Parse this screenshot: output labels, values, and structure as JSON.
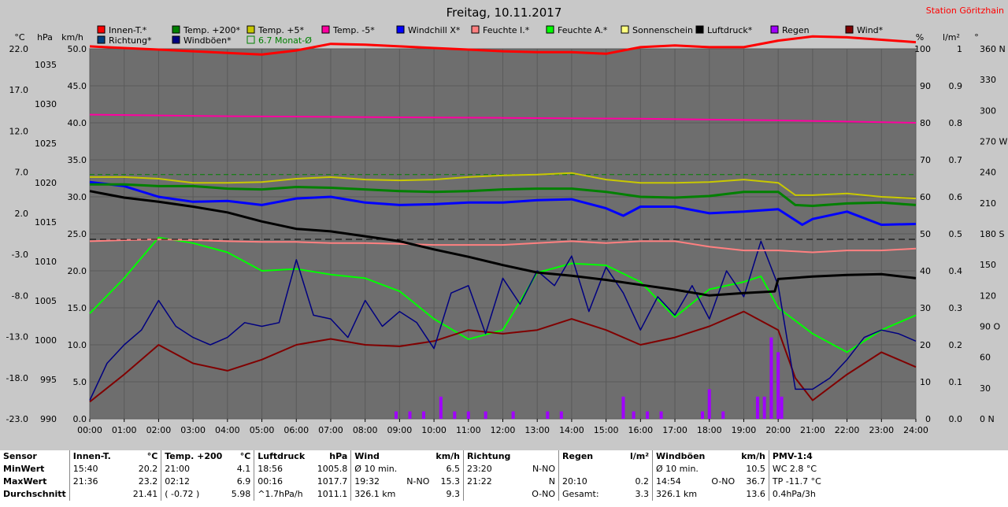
{
  "chart_data": {
    "type": "line",
    "title": "Freitag, 10.11.2017",
    "station": "Station Göritzhain",
    "x_ticks": [
      "00:00",
      "01:00",
      "02:00",
      "03:00",
      "04:00",
      "05:00",
      "06:00",
      "07:00",
      "08:00",
      "09:00",
      "10:00",
      "11:00",
      "12:00",
      "13:00",
      "14:00",
      "15:00",
      "16:00",
      "17:00",
      "18:00",
      "19:00",
      "20:00",
      "21:00",
      "22:00",
      "23:00",
      "24:00"
    ],
    "xlim": [
      0,
      24
    ],
    "axes": {
      "temp_c": {
        "label": "°C",
        "ticks": [
          "22.0",
          "17.0",
          "12.0",
          "7.0",
          "2.0",
          "-3.0",
          "-8.0",
          "-13.0",
          "-18.0",
          "-23.0"
        ],
        "range": [
          -23,
          22
        ]
      },
      "pressure_hpa": {
        "label": "hPa",
        "ticks": [
          "1035",
          "1030",
          "1025",
          "1020",
          "1015",
          "1010",
          "1005",
          "1000",
          "995",
          "990"
        ],
        "range": [
          990,
          1035
        ]
      },
      "wind_kmh": {
        "label": "km/h",
        "ticks": [
          "50.0",
          "45.0",
          "40.0",
          "35.0",
          "30.0",
          "25.0",
          "20.0",
          "15.0",
          "10.0",
          "5.0",
          "0.0"
        ],
        "range": [
          0,
          50
        ]
      },
      "humidity_pct": {
        "label": "%",
        "ticks": [
          "100",
          "90",
          "80",
          "70",
          "60",
          "50",
          "40",
          "30",
          "20",
          "10",
          "0"
        ],
        "range": [
          0,
          100
        ]
      },
      "rain_lm2": {
        "label": "l/m²",
        "ticks": [
          "1",
          "0.9",
          "0.8",
          "0.7",
          "0.6",
          "0.5",
          "0.4",
          "0.3",
          "0.2",
          "0.1",
          "0.0"
        ],
        "range": [
          0,
          1
        ]
      },
      "direction_deg": {
        "label": "°",
        "ticks": [
          "360 N",
          "330",
          "300",
          "270 W",
          "240",
          "210",
          "180 S",
          "150",
          "120",
          "90 O",
          "60",
          "30",
          "0 N"
        ],
        "range": [
          0,
          360
        ]
      }
    },
    "legend": [
      {
        "name": "Innen-T.*",
        "color": "#ff0000"
      },
      {
        "name": "Temp. +200*",
        "color": "#008000"
      },
      {
        "name": "Temp. +5*",
        "color": "#c8c800"
      },
      {
        "name": "Temp. -5*",
        "color": "#ff00a0"
      },
      {
        "name": "Windchill X*",
        "color": "#0000ff"
      },
      {
        "name": "Feuchte I.*",
        "color": "#ff8080"
      },
      {
        "name": "Feuchte A.*",
        "color": "#00ff00"
      },
      {
        "name": "Sonnenschein",
        "color": "#ffff80"
      },
      {
        "name": "Luftdruck*",
        "color": "#000000"
      },
      {
        "name": "Regen",
        "color": "#a000ff"
      },
      {
        "name": "Wind*",
        "color": "#800000"
      },
      {
        "name": "Richtung*",
        "color": "#004080"
      },
      {
        "name": "Windböen*",
        "color": "#000080"
      },
      {
        "name": "6.7 Monat-Ø",
        "color": "#008000"
      }
    ],
    "series": [
      {
        "name": "Innen-T.*",
        "axis": "temp_c",
        "x": [
          0,
          1,
          2,
          3,
          4,
          5,
          6,
          7,
          8,
          9,
          10,
          11,
          12,
          13,
          14,
          15,
          16,
          17,
          18,
          19,
          20,
          21,
          22,
          23,
          24
        ],
        "y": [
          22.3,
          22.1,
          21.9,
          21.7,
          21.5,
          21.3,
          21.8,
          22.6,
          22.5,
          22.3,
          22.1,
          21.9,
          21.7,
          21.6,
          21.6,
          21.4,
          22.2,
          22.4,
          22.2,
          22.2,
          23.0,
          23.5,
          23.4,
          23.1,
          22.8
        ]
      },
      {
        "name": "Temp. -5*",
        "axis": "temp_c",
        "x": [
          0,
          4,
          8,
          12,
          16,
          20,
          24
        ],
        "y": [
          14.0,
          13.8,
          13.7,
          13.6,
          13.5,
          13.3,
          13.0
        ]
      },
      {
        "name": "Temp. +5*",
        "axis": "temp_c",
        "x": [
          0,
          1,
          2,
          3,
          4,
          5,
          6,
          7,
          8,
          9,
          10,
          11,
          12,
          13,
          14,
          15,
          16,
          17,
          18,
          19,
          20,
          20.5,
          21,
          22,
          23,
          24
        ],
        "y": [
          6.4,
          6.4,
          6.2,
          5.7,
          5.7,
          5.8,
          6.2,
          6.4,
          6.1,
          6.0,
          6.1,
          6.4,
          6.6,
          6.7,
          6.9,
          6.1,
          5.7,
          5.7,
          5.8,
          6.1,
          5.7,
          4.2,
          4.2,
          4.4,
          4.0,
          3.8
        ]
      },
      {
        "name": "Temp. +200*",
        "axis": "temp_c",
        "x": [
          0,
          1,
          2,
          3,
          4,
          5,
          6,
          7,
          8,
          9,
          10,
          11,
          12,
          13,
          14,
          15,
          16,
          17,
          18,
          19,
          20,
          20.5,
          21,
          22,
          23,
          24
        ],
        "y": [
          5.5,
          5.5,
          5.3,
          5.3,
          5.0,
          4.9,
          5.2,
          5.1,
          4.9,
          4.7,
          4.6,
          4.7,
          4.9,
          5.0,
          5.0,
          4.6,
          4.0,
          3.9,
          4.1,
          4.6,
          4.6,
          3.0,
          2.9,
          3.2,
          3.3,
          3.0
        ]
      },
      {
        "name": "Windchill X*",
        "axis": "temp_c",
        "x": [
          0,
          1,
          2,
          3,
          4,
          5,
          6,
          7,
          8,
          9,
          10,
          11,
          12,
          13,
          14,
          15,
          15.5,
          16,
          17,
          18,
          19,
          20,
          20.7,
          21,
          22,
          23,
          24
        ],
        "y": [
          5.8,
          5.3,
          4.0,
          3.4,
          3.5,
          3.0,
          3.8,
          4.0,
          3.3,
          3.0,
          3.1,
          3.3,
          3.3,
          3.6,
          3.7,
          2.6,
          1.7,
          2.8,
          2.8,
          2.0,
          2.2,
          2.5,
          0.6,
          1.3,
          2.2,
          0.6,
          0.7
        ]
      },
      {
        "name": "Luftdruck*",
        "axis": "pressure_hpa",
        "x": [
          0,
          1,
          2,
          3,
          4,
          5,
          6,
          7,
          8,
          9,
          10,
          11,
          12,
          13,
          14,
          15,
          16,
          17,
          18,
          19,
          19.9,
          20,
          21,
          22,
          23,
          24
        ],
        "y": [
          1017.7,
          1016.9,
          1016.4,
          1015.8,
          1015.1,
          1014.0,
          1013.1,
          1012.8,
          1012.2,
          1011.6,
          1010.6,
          1009.7,
          1008.7,
          1007.8,
          1007.4,
          1006.9,
          1006.3,
          1005.7,
          1005.0,
          1005.3,
          1005.5,
          1007.0,
          1007.3,
          1007.5,
          1007.6,
          1007.1
        ]
      },
      {
        "name": "Feuchte I.*",
        "axis": "humidity_pct",
        "x": [
          0,
          1,
          2,
          3,
          4,
          5,
          6,
          7,
          8,
          9,
          10,
          11,
          12,
          13,
          14,
          15,
          16,
          17,
          18,
          19,
          20,
          21,
          22,
          23,
          24
        ],
        "y": [
          48.0,
          48.3,
          48.5,
          48.3,
          48.0,
          47.8,
          47.8,
          47.5,
          47.5,
          47.3,
          47.0,
          47.0,
          47.0,
          47.5,
          48.0,
          47.5,
          48.0,
          48.0,
          46.5,
          45.5,
          45.5,
          45.0,
          45.5,
          45.5,
          46.0
        ]
      },
      {
        "name": "Feuchte A.*",
        "axis": "humidity_pct",
        "x": [
          0,
          1,
          2,
          3,
          4,
          5,
          6,
          7,
          8,
          9,
          10,
          11,
          12,
          13,
          14,
          15,
          16,
          17,
          18,
          19,
          19.5,
          20,
          21,
          22,
          23,
          24
        ],
        "y": [
          28.5,
          38.0,
          49.0,
          47.5,
          45.0,
          40.0,
          40.5,
          39.0,
          38.0,
          34.5,
          27.0,
          21.5,
          24.0,
          39.5,
          42.0,
          41.5,
          37.0,
          27.5,
          35.0,
          37.0,
          38.5,
          30.0,
          23.0,
          18.0,
          24.0,
          28.0
        ]
      },
      {
        "name": "Wind*",
        "axis": "wind_kmh",
        "x": [
          0,
          1,
          2,
          3,
          4,
          5,
          6,
          7,
          8,
          9,
          10,
          11,
          12,
          13,
          14,
          15,
          16,
          17,
          18,
          19,
          20,
          20.5,
          21,
          22,
          23,
          24
        ],
        "y": [
          2.3,
          6.0,
          10.0,
          7.5,
          6.5,
          8.0,
          10.0,
          10.8,
          10.0,
          9.8,
          10.5,
          12.0,
          11.5,
          12.0,
          13.5,
          12.0,
          10.0,
          11.0,
          12.5,
          14.5,
          12.0,
          5.5,
          2.5,
          6.0,
          9.0,
          7.0
        ]
      },
      {
        "name": "Windböen*",
        "axis": "wind_kmh",
        "x": [
          0,
          0.5,
          1,
          1.5,
          2,
          2.5,
          3,
          3.5,
          4,
          4.5,
          5,
          5.5,
          6,
          6.5,
          7,
          7.5,
          8,
          8.5,
          9,
          9.5,
          10,
          10.5,
          11,
          11.5,
          12,
          12.5,
          13,
          13.5,
          14,
          14.5,
          15,
          15.5,
          16,
          16.5,
          17,
          17.5,
          18,
          18.5,
          19,
          19.5,
          20,
          20.5,
          21,
          21.5,
          22,
          22.5,
          23,
          23.5,
          24
        ],
        "y": [
          2.5,
          7.5,
          10.0,
          12.0,
          16.0,
          12.5,
          11.0,
          10.0,
          11.0,
          13.0,
          12.5,
          13.0,
          21.5,
          14.0,
          13.5,
          11.0,
          16.0,
          12.5,
          14.5,
          13.0,
          9.5,
          17.0,
          18.0,
          11.5,
          19.0,
          15.5,
          20.0,
          18.0,
          22.0,
          14.5,
          20.5,
          17.0,
          12.0,
          16.5,
          14.0,
          18.0,
          13.5,
          20.0,
          16.5,
          24.0,
          18.0,
          4.0,
          4.0,
          5.5,
          8.0,
          11.0,
          12.0,
          11.5,
          10.5
        ]
      },
      {
        "name": "Regen",
        "axis": "rain_lm2",
        "type": "bar",
        "x": [
          8.9,
          9.3,
          9.7,
          10.2,
          10.6,
          11.0,
          11.5,
          12.3,
          13.3,
          13.7,
          15.5,
          15.8,
          16.2,
          16.6,
          17.8,
          18.0,
          18.4,
          19.4,
          19.6,
          19.8,
          20.0,
          20.1
        ],
        "y": [
          0.02,
          0.02,
          0.02,
          0.06,
          0.02,
          0.02,
          0.02,
          0.02,
          0.02,
          0.02,
          0.06,
          0.02,
          0.02,
          0.02,
          0.02,
          0.08,
          0.02,
          0.06,
          0.06,
          0.22,
          0.18,
          0.06
        ]
      },
      {
        "name": "6.7 Monat-Ø",
        "axis": "temp_c",
        "x": [
          0,
          24
        ],
        "y": [
          6.7,
          6.7
        ]
      }
    ],
    "grid": true,
    "legend_placement": "top"
  },
  "summary": {
    "headers": {
      "sensor": "Sensor",
      "innen": "Innen-T.",
      "innen_unit": "°C",
      "temp": "Temp. +200",
      "temp_unit": "°C",
      "luft": "Luftdruck",
      "luft_unit": "hPa",
      "wind": "Wind",
      "wind_unit": "km/h",
      "richt": "Richtung",
      "regen": "Regen",
      "regen_unit": "l/m²",
      "boe": "Windböen",
      "boe_unit": "km/h",
      "pmv": "PMV-1:4"
    },
    "rows": [
      {
        "label": "MinWert",
        "innen_t": "15:40",
        "innen_v": "20.2",
        "temp_t": "21:00",
        "temp_v": "4.1",
        "luft_t": "18:56",
        "luft_v": "1005.8",
        "wind_t": "Ø 10 min.",
        "wind_d": "",
        "wind_v": "6.5",
        "richt_t": "23:20",
        "richt_v": "N-NO",
        "regen_t": "",
        "regen_v": "",
        "boe_t": "Ø 10 min.",
        "boe_d": "",
        "boe_v": "10.5",
        "pmv": "WC 2.8 °C"
      },
      {
        "label": "MaxWert",
        "innen_t": "21:36",
        "innen_v": "23.2",
        "temp_t": "02:12",
        "temp_v": "6.9",
        "luft_t": "00:16",
        "luft_v": "1017.7",
        "wind_t": "19:32",
        "wind_d": "N-NO",
        "wind_v": "15.3",
        "richt_t": "21:22",
        "richt_v": "N",
        "regen_t": "20:10",
        "regen_v": "0.2",
        "boe_t": "14:54",
        "boe_d": "O-NO",
        "boe_v": "36.7",
        "pmv": "TP -11.7 °C"
      },
      {
        "label": "Durchschnitt",
        "innen_t": "",
        "innen_v": "21.41",
        "temp_t": "( -0.72 )",
        "temp_v": "5.98",
        "luft_t": "^1.7hPa/h",
        "luft_v": "1011.1",
        "wind_t": "326.1 km",
        "wind_d": "",
        "wind_v": "9.3",
        "richt_t": "",
        "richt_v": "O-NO",
        "regen_t": "Gesamt:",
        "regen_v": "3.3",
        "boe_t": "326.1 km",
        "boe_d": "",
        "boe_v": "13.6",
        "pmv": "0.4hPa/3h"
      }
    ]
  }
}
